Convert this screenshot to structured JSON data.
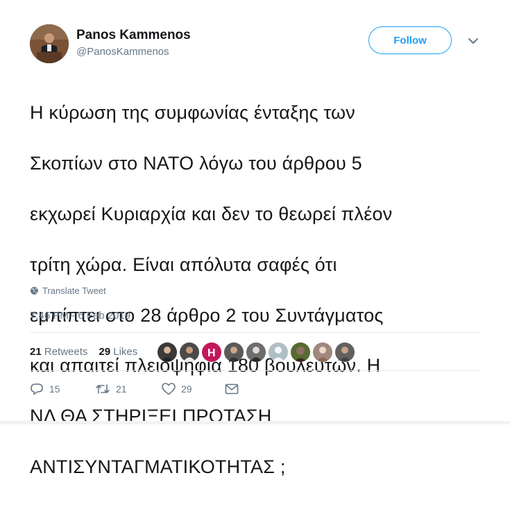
{
  "user": {
    "name": "Panos Kammenos",
    "handle": "@PanosKammenos"
  },
  "follow_label": "Follow",
  "tweet": {
    "lines": [
      "Η κύρωση της συμφωνίας ένταξης των",
      "Σκοπίων στο ΝΑΤΟ λόγω του άρθρου 5",
      "εκχωρεί Κυριαρχία και δεν το θεωρεί πλέον",
      "τρίτη χώρα. Είναι απόλυτα σαφές ότι",
      "εμπίπτει στο 28 άρθρο 2 του Συντάγματος",
      "και απαιτεί πλειοψηφία 180 βουλευτών. Η",
      "ΝΔ ΘΑ ΣΤΗΡΙΞΕΙ ΠΡΟΤΑΣΗ",
      "ΑΝΤΙΣΥΝΤΑΓΜΑΤΙΚΟΤΗΤΑΣ ;"
    ]
  },
  "translate_label": "Translate Tweet",
  "timestamp": "7:46 PM - 6 Feb 2019",
  "stats": {
    "retweets_count": "21",
    "retweets_label": "Retweets",
    "likes_count": "29",
    "likes_label": "Likes"
  },
  "likers": [
    {
      "icon": "liker-avatar-1",
      "bg": "#3a3a3a"
    },
    {
      "icon": "liker-avatar-2",
      "bg": "#4a4a4a"
    },
    {
      "icon": "liker-avatar-3",
      "bg": "#c2185b"
    },
    {
      "icon": "liker-avatar-4",
      "bg": "#5a5a5a"
    },
    {
      "icon": "liker-avatar-5",
      "bg": "#6d6d6d"
    },
    {
      "icon": "liker-avatar-6",
      "bg": "#b0bec5"
    },
    {
      "icon": "liker-avatar-7",
      "bg": "#556b2f"
    },
    {
      "icon": "liker-avatar-8",
      "bg": "#a1887f"
    },
    {
      "icon": "liker-avatar-9",
      "bg": "#616161"
    }
  ],
  "actions": {
    "replies": "15",
    "retweets": "21",
    "likes": "29"
  },
  "colors": {
    "accent": "#1da1f2",
    "secondary_text": "#657786",
    "divider": "#e6ecf0"
  }
}
